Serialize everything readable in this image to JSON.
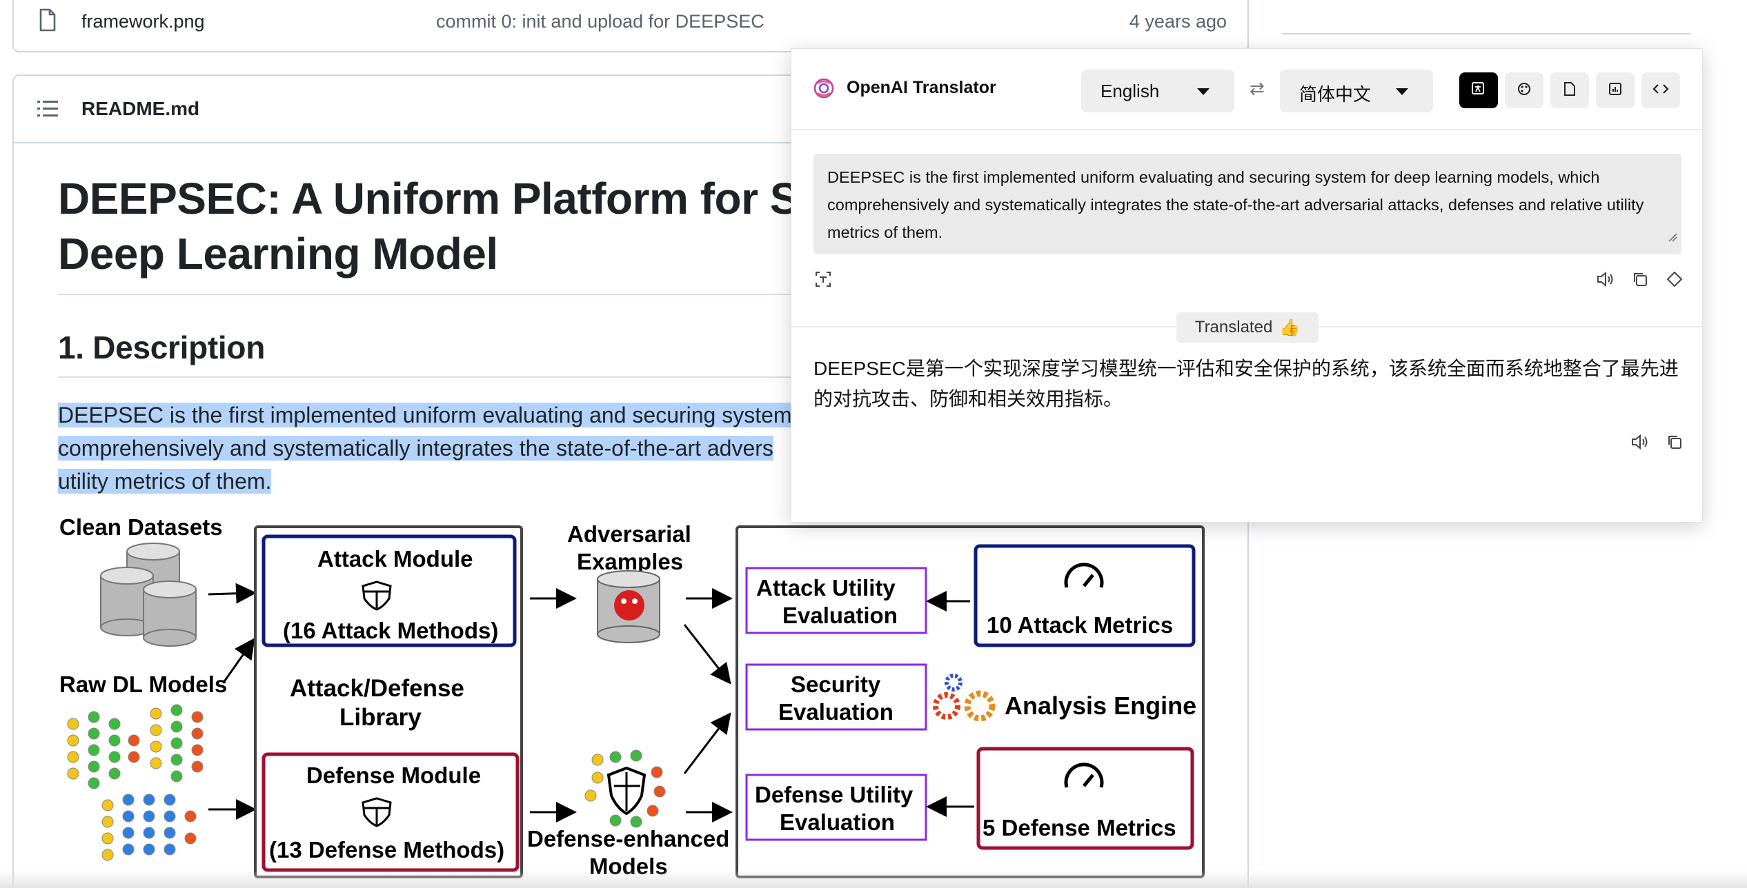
{
  "file_row": {
    "name": "framework.png",
    "commit": "commit 0: init and upload for DEEPSEC",
    "time": "4 years ago",
    "icon": "file-icon"
  },
  "readme": {
    "filename": "README.md",
    "title_line1": "DEEPSEC: A Uniform Platform for Sec",
    "title_line2": "Deep Learning Model",
    "section_heading": "1. Description",
    "desc_line1": "DEEPSEC is the first implemented uniform evaluating and securing system",
    "desc_line2": "comprehensively and systematically integrates the state-of-the-art advers",
    "desc_line3": "utility metrics of them.",
    "highlight_color": "#b3d3fb"
  },
  "diagram": {
    "clean_datasets": "Clean Datasets",
    "raw_models": "Raw DL Models",
    "attack_module": "Attack Module",
    "attack_methods": "(16 Attack Methods)",
    "library_line1": "Attack/Defense",
    "library_line2": "Library",
    "defense_module": "Defense Module",
    "defense_methods": "(13 Defense Methods)",
    "adv_line1": "Adversarial",
    "adv_line2": "Examples",
    "def_enh_line1": "Defense-enhanced",
    "def_enh_line2": "Models",
    "attack_util_line1": "Attack Utility",
    "attack_util_line2": "Evaluation",
    "security_line1": "Security",
    "security_line2": "Evaluation",
    "defense_util_line1": "Defense Utility",
    "defense_util_line2": "Evaluation",
    "attack_metrics": "10 Attack Metrics",
    "analysis_engine": "Analysis Engine",
    "defense_metrics": "5 Defense Metrics",
    "colors": {
      "navy": "#0d1b7a",
      "purple": "#8a2be2",
      "red": "#a01030"
    }
  },
  "translator": {
    "app_name": "OpenAI Translator",
    "source_lang": "English",
    "target_lang": "简体中文",
    "source_text": "DEEPSEC is the first implemented uniform evaluating and securing system for deep learning models, which comprehensively and systematically integrates the state-of-the-art adversarial attacks, defenses and relative utility metrics of them.",
    "status": "Translated",
    "status_emoji": "👍",
    "translated_text": "DEEPSEC是第一个实现深度学习模型统一评估和安全保护的系统，该系统全面而系统地整合了最先进的对抗攻击、防御和相关效用指标。",
    "icons": [
      "openai-logo-icon",
      "swap-icon",
      "translate-mode-icon",
      "polish-mode-icon",
      "summarize-mode-icon",
      "analyze-mode-icon",
      "explain-code-icon",
      "ocr-icon",
      "speak-icon",
      "copy-icon",
      "eraser-icon"
    ]
  }
}
